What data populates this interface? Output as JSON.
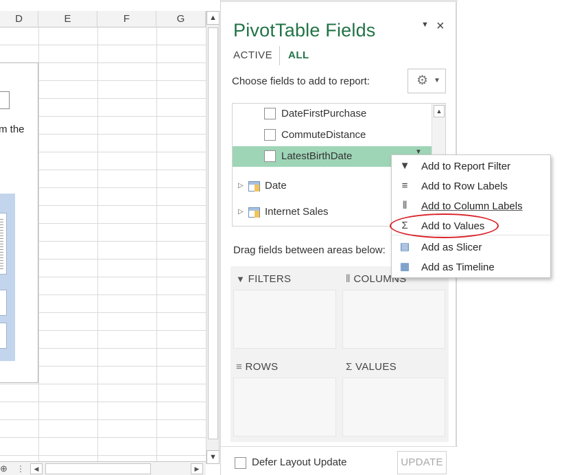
{
  "sheet": {
    "columns": [
      "D",
      "E",
      "F",
      "G"
    ],
    "placeholder_text": "m the",
    "scroll_up": "▲",
    "scroll_down": "▼"
  },
  "sheet_bottom": {
    "left_glyph": "⊕",
    "grip": "⋮",
    "prev": "◀",
    "next": "▶"
  },
  "pane": {
    "title": "PivotTable Fields",
    "menu_glyph": "▼",
    "close_glyph": "×",
    "tabs": [
      {
        "label": "ACTIVE",
        "active": false
      },
      {
        "label": "ALL",
        "active": true
      }
    ],
    "choose_label": "Choose fields to add to report:",
    "gear_glyph": "⚙",
    "gear_caret": "▼",
    "fields": [
      {
        "label": "DateFirstPurchase",
        "checked": false,
        "selected": false
      },
      {
        "label": "CommuteDistance",
        "checked": false,
        "selected": false
      },
      {
        "label": "LatestBirthDate",
        "checked": false,
        "selected": true
      }
    ],
    "field_dropdown_glyph": "▼",
    "tables": [
      {
        "label": "Date"
      },
      {
        "label": "Internet Sales"
      }
    ],
    "drag_label": "Drag fields between areas below:",
    "areas": [
      {
        "key": "filters",
        "label": "FILTERS",
        "icon": "filter-icon",
        "glyph": "▼"
      },
      {
        "key": "columns",
        "label": "COLUMNS",
        "icon": "columns-icon",
        "glyph": "⦀"
      },
      {
        "key": "rows",
        "label": "ROWS",
        "icon": "rows-icon",
        "glyph": "≡"
      },
      {
        "key": "values",
        "label": "VALUES",
        "icon": "sigma-icon",
        "glyph": "Σ"
      }
    ],
    "defer_label": "Defer Layout Update",
    "update_label": "UPDATE"
  },
  "context_menu": {
    "items": [
      {
        "label": "Add to Report Filter",
        "icon": "filter-icon",
        "glyph": "▼"
      },
      {
        "label": "Add to Row Labels",
        "icon": "rows-icon",
        "glyph": "≡"
      },
      {
        "label": "Add to Column Labels",
        "icon": "columns-icon",
        "glyph": "⦀"
      },
      {
        "label": "Add to Values",
        "icon": "sigma-icon",
        "glyph": "Σ"
      },
      {
        "label": "Add as Slicer",
        "icon": "slicer-icon",
        "glyph": "▤"
      },
      {
        "label": "Add as Timeline",
        "icon": "timeline-icon",
        "glyph": "▦"
      }
    ]
  },
  "colors": {
    "accent": "#217346",
    "selection": "#9fd5b7",
    "annotation": "#d9232a"
  }
}
